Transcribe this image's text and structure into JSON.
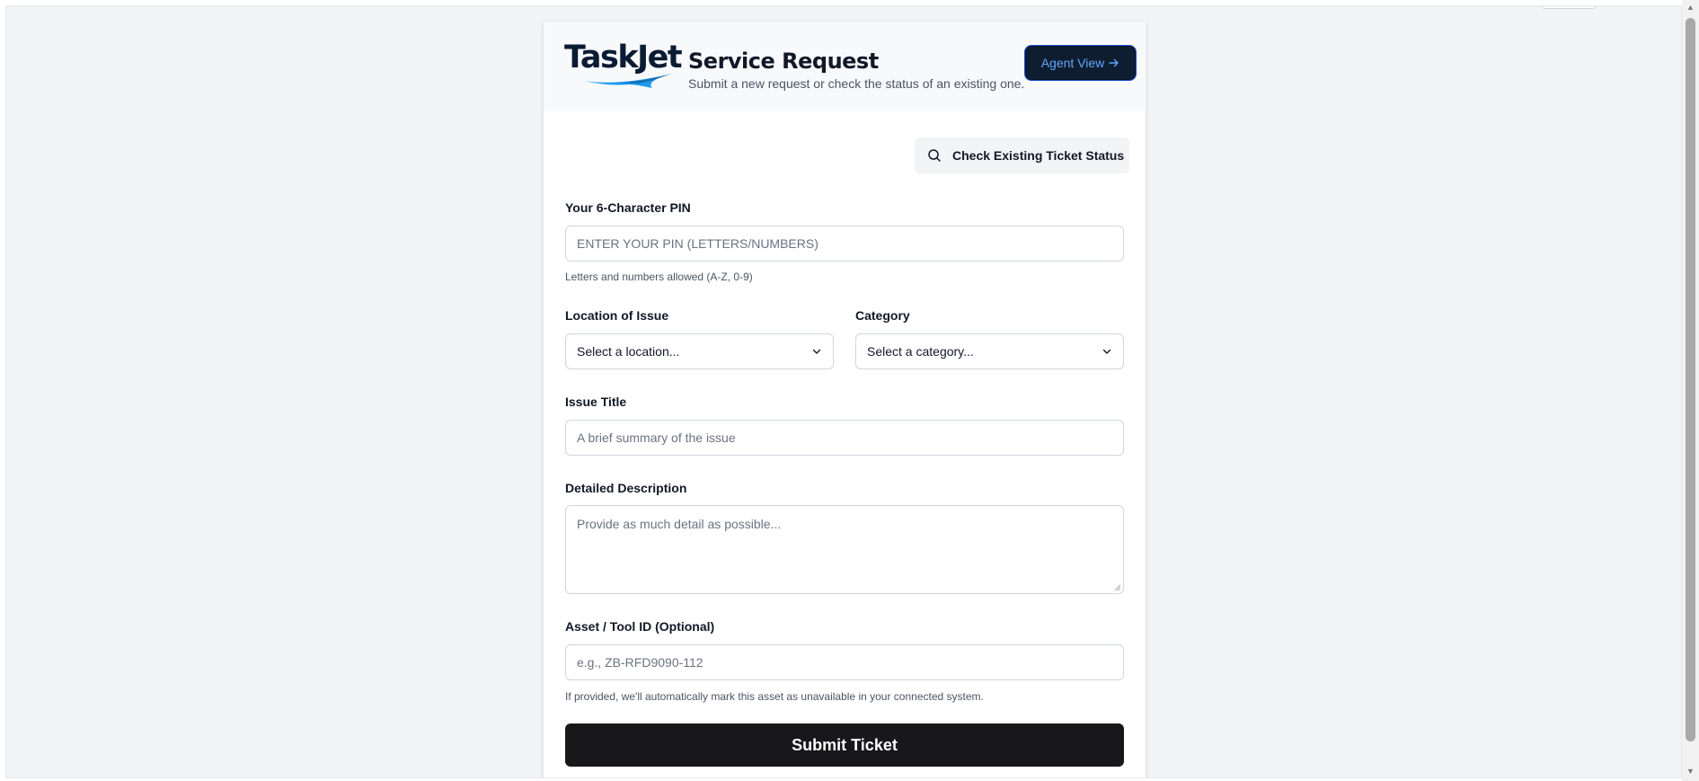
{
  "header": {
    "logo_text": "TaskJet",
    "title": "Service Request",
    "subtitle": "Submit a new request or check the status of an existing one.",
    "agent_view_label": "Agent View"
  },
  "check_status": {
    "label": "Check Existing Ticket Status",
    "icon": "search-icon"
  },
  "form": {
    "pin": {
      "label": "Your 6-Character PIN",
      "placeholder": "ENTER YOUR PIN (LETTERS/NUMBERS)",
      "hint": "Letters and numbers allowed (A-Z, 0-9)"
    },
    "location": {
      "label": "Location of Issue",
      "selected": "Select a location..."
    },
    "category": {
      "label": "Category",
      "selected": "Select a category..."
    },
    "title": {
      "label": "Issue Title",
      "placeholder": "A brief summary of the issue"
    },
    "description": {
      "label": "Detailed Description",
      "placeholder": "Provide as much detail as possible..."
    },
    "asset": {
      "label": "Asset / Tool ID (Optional)",
      "placeholder": "e.g., ZB-RFD9090-112",
      "hint": "If provided, we'll automatically mark this asset as unavailable in your connected system."
    },
    "submit_label": "Submit Ticket"
  },
  "colors": {
    "brand_navy": "#0b1b33",
    "swoosh_blue": "#1d9bf0",
    "agent_button_bg": "#0f1d30",
    "agent_button_text": "#60a5fa",
    "submit_bg": "#18181b"
  }
}
